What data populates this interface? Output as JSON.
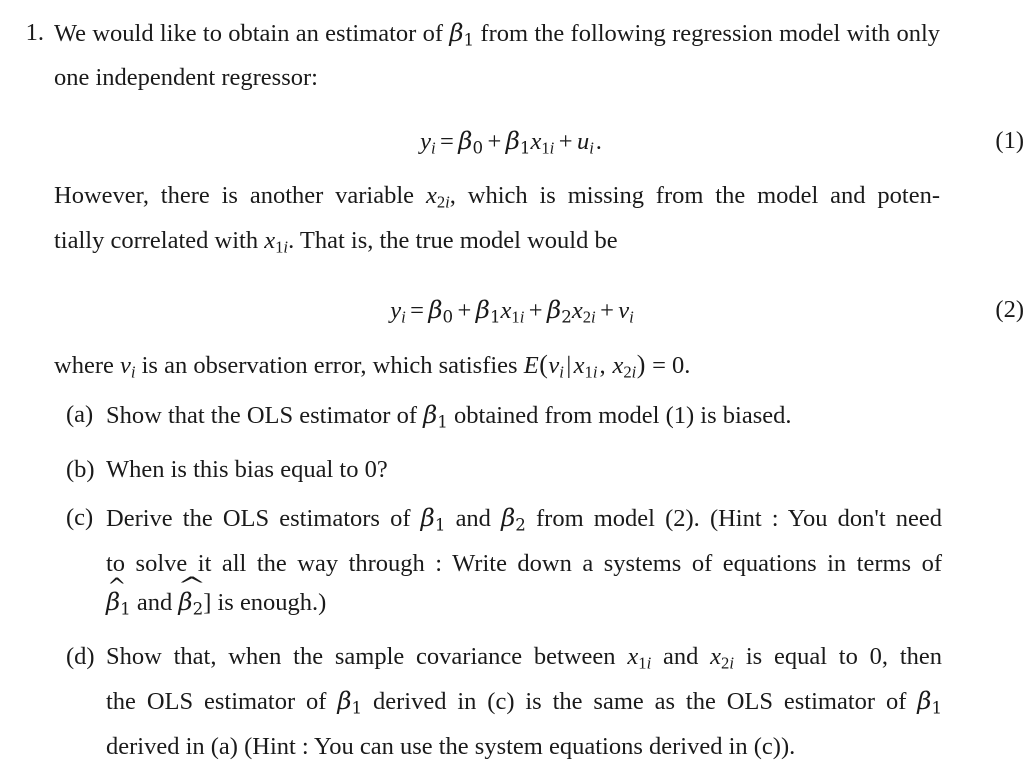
{
  "document": {
    "type": "math-problem-set",
    "background_color": "#ffffff",
    "text_color": "#1a1a1a"
  },
  "problem": {
    "number": "1.",
    "intro_line1": "We would like to obtain an estimator of",
    "intro_line1_after": "from the following regression model with",
    "intro_line2": "only one independent regressor:",
    "beta1_inline": "β₁"
  },
  "equations": [
    {
      "id": "eq1",
      "number": "(1)",
      "latex": "y_i = \\beta_0 + \\beta_1 x_{1i} + u_i.",
      "plain": "y_i = β₀ + β₁x₁ᵢ + uᵢ."
    },
    {
      "id": "eq2",
      "number": "(2)",
      "latex": "y_i = \\beta_0 + \\beta_1 x_{1i} + \\beta_2 x_{2i} + v_i",
      "plain": "y_i = β₀ + β₁x₁ᵢ + β₂x₂ᵢ + vᵢ"
    }
  ],
  "paragraphs": {
    "after_eq1_line1": "However, there is another variable",
    "after_eq1_line1b": ", which is missing from the model and poten-",
    "after_eq1_line2a": "tially correlated with",
    "after_eq1_line2b": ". That is, the true model would be",
    "after_eq2_a": "where",
    "after_eq2_b": "is an observation error, which satisfies",
    "after_eq2_c": "= 0."
  },
  "subquestions": [
    {
      "marker": "(a)",
      "lines": [
        "Show that the OLS estimator of β₁ obtained from model (1) is biased."
      ],
      "text": "Show that the OLS estimator of β1 obtained from model (1) is biased."
    },
    {
      "marker": "(b)",
      "lines": [
        "When is this bias equal to 0?"
      ],
      "text": "When is this bias equal to 0?"
    },
    {
      "marker": "(c)",
      "lines": [
        "Derive the OLS estimators of β₁ and β₂ from model (2). (Hint : You don't need",
        "to solve it all the way through : Write down a systems of equations in terms of",
        "β̂₁ and β̂₂] is enough.)"
      ],
      "text": "Derive the OLS estimators of β1 and β2 from model (2). (Hint : You don't need to solve it all the way through : Write down a systems of equations in terms of β̂1 and β̂2] is enough.)"
    },
    {
      "marker": "(d)",
      "lines": [
        "Show that, when the sample covariance between x₁ᵢ and x₂ᵢ is equal to 0, then",
        "the OLS estimator of β₁ derived in (c) is the same as the OLS estimator of β₁",
        "derived in (a) (Hint : You can use the system equations derived in (c))."
      ],
      "text": "Show that, when the sample covariance between x1i and x2i is equal to 0, then the OLS estimator of β1 derived in (c) is the same as the OLS estimator of β1 derived in (a) (Hint : You can use the system equations derived in (c))."
    }
  ],
  "fragments": {
    "c_line1_a": "Derive the OLS estimators of",
    "c_line1_and": "and",
    "c_line1_b": "from model (2). (Hint : You don't need",
    "c_line2": "to solve it all the way through : Write down a systems of equations in terms of",
    "c_line3_and": "and",
    "c_line3_tail": "] is enough.)",
    "d_line1_a": "Show that, when the sample covariance between",
    "d_line1_and": "and",
    "d_line1_b": "is equal to 0, then",
    "d_line2_a": "the OLS estimator of",
    "d_line2_b": "derived in (c) is the same as the OLS estimator of",
    "d_line3": "derived in (a) (Hint : You can use the system equations derived in (c)).",
    "a_line_a": "Show that the OLS estimator of",
    "a_line_b": "obtained from model (1) is biased.",
    "b_line": "When is this bias equal to 0?"
  },
  "symbols": {
    "beta": "β",
    "hat": "̂",
    "hat_glyph": "^",
    "zero": "0",
    "one": "1",
    "two": "2",
    "i": "i",
    "x": "x",
    "y": "y",
    "u": "u",
    "v": "v",
    "E": "E",
    "equals": "=",
    "plus": "+",
    "period": ".",
    "comma": ",",
    "bar": "|"
  }
}
